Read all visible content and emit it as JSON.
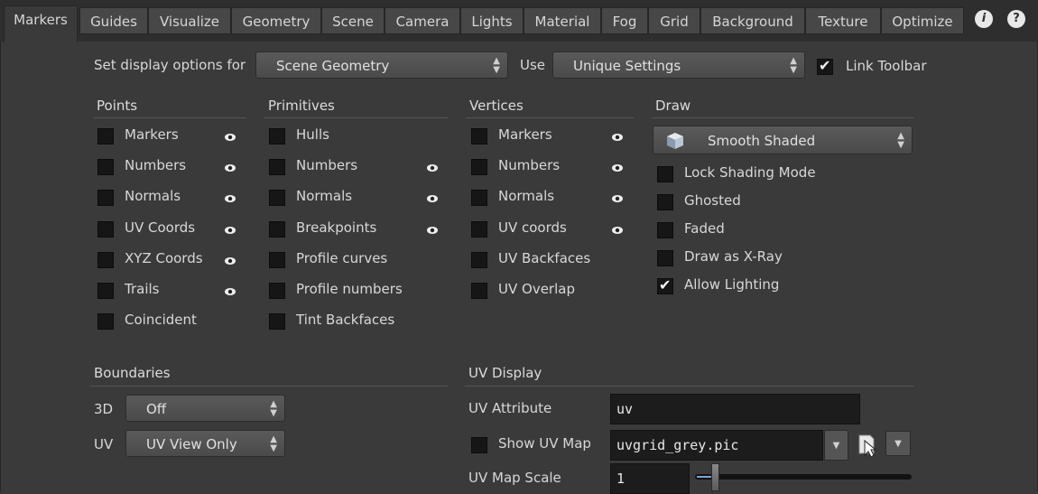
{
  "tabs": [
    "Markers",
    "Guides",
    "Visualize",
    "Geometry",
    "Scene",
    "Camera",
    "Lights",
    "Material",
    "Fog",
    "Grid",
    "Background",
    "Texture",
    "Optimize"
  ],
  "active_tab": "Markers",
  "top_icons": {
    "info": "i",
    "help": "?"
  },
  "options_row": {
    "set_display_label": "Set display options for",
    "set_display_value": "Scene Geometry",
    "use_label": "Use",
    "use_value": "Unique Settings",
    "link_toolbar_label": "Link Toolbar",
    "link_toolbar_checked": true
  },
  "points": {
    "title": "Points",
    "items": [
      {
        "label": "Markers",
        "checked": false,
        "eye": true
      },
      {
        "label": "Numbers",
        "checked": false,
        "eye": true
      },
      {
        "label": "Normals",
        "checked": false,
        "eye": true
      },
      {
        "label": "UV Coords",
        "checked": false,
        "eye": true
      },
      {
        "label": "XYZ Coords",
        "checked": false,
        "eye": true
      },
      {
        "label": "Trails",
        "checked": false,
        "eye": true
      },
      {
        "label": "Coincident",
        "checked": false,
        "eye": false
      }
    ]
  },
  "primitives": {
    "title": "Primitives",
    "items": [
      {
        "label": "Hulls",
        "checked": false,
        "eye": false
      },
      {
        "label": "Numbers",
        "checked": false,
        "eye": true
      },
      {
        "label": "Normals",
        "checked": false,
        "eye": true
      },
      {
        "label": "Breakpoints",
        "checked": false,
        "eye": true
      },
      {
        "label": "Profile curves",
        "checked": false,
        "eye": false
      },
      {
        "label": "Profile numbers",
        "checked": false,
        "eye": false
      },
      {
        "label": "Tint Backfaces",
        "checked": false,
        "eye": false
      }
    ]
  },
  "vertices": {
    "title": "Vertices",
    "items": [
      {
        "label": "Markers",
        "checked": false,
        "eye": true
      },
      {
        "label": "Numbers",
        "checked": false,
        "eye": true
      },
      {
        "label": "Normals",
        "checked": false,
        "eye": true
      },
      {
        "label": "UV coords",
        "checked": false,
        "eye": true
      },
      {
        "label": "UV Backfaces",
        "checked": false,
        "eye": false
      },
      {
        "label": "UV Overlap",
        "checked": false,
        "eye": false
      }
    ]
  },
  "draw": {
    "title": "Draw",
    "mode": "Smooth Shaded",
    "items": [
      {
        "label": "Lock Shading Mode",
        "checked": false
      },
      {
        "label": "Ghosted",
        "checked": false
      },
      {
        "label": "Faded",
        "checked": false
      },
      {
        "label": "Draw as X-Ray",
        "checked": false
      },
      {
        "label": "Allow Lighting",
        "checked": true
      }
    ]
  },
  "boundaries": {
    "title": "Boundaries",
    "label_3d": "3D",
    "value_3d": "Off",
    "label_uv": "UV",
    "value_uv": "UV View Only"
  },
  "uv_display": {
    "title": "UV Display",
    "attribute_label": "UV Attribute",
    "attribute_value": "uv",
    "show_map_label": "Show UV Map",
    "show_map_checked": false,
    "map_file": "uvgrid_grey.pic",
    "scale_label": "UV Map Scale",
    "scale_value": "1"
  },
  "colors": {
    "panel": "#3a3a3a",
    "tabbar": "#2e2e2e",
    "field": "#1c1c1c",
    "checkbox": "#161616"
  },
  "icons": {
    "eye": "eye-icon",
    "cube": "cube-icon",
    "file_chooser": "file-chooser-icon",
    "dropdown": "chevron-down-icon"
  }
}
